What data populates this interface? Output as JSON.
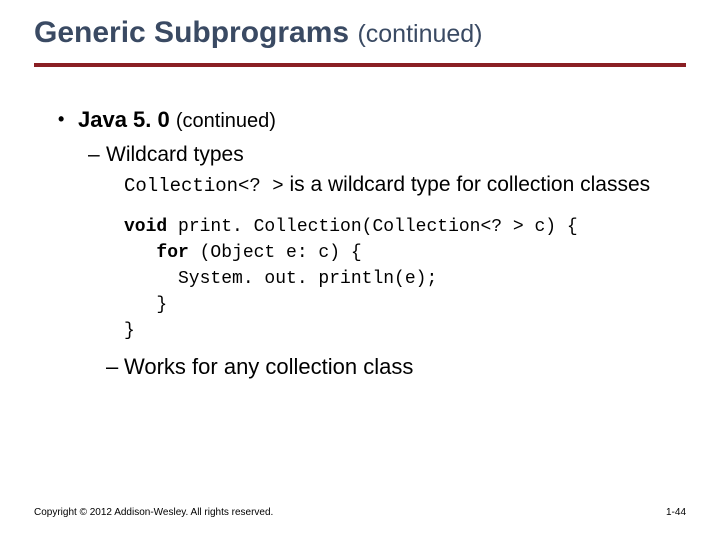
{
  "title": {
    "main": "Generic Subprograms",
    "cont": "(continued)"
  },
  "bullets": {
    "java_label": "Java 5. 0",
    "java_cont": "(continued)",
    "wildcard_label": "Wildcard types",
    "wildcard_code": "Collection<? >",
    "wildcard_desc_tail": " is a wildcard type for collection classes",
    "code_l1a": "void",
    "code_l1b": " print. Collection(Collection<? > c) {",
    "code_l2a": "   for",
    "code_l2b": " (Object e: c) {",
    "code_l3": "     System. out. println(e);",
    "code_l4": "   }",
    "code_l5": "}",
    "works_line": "Works for any collection class"
  },
  "footer": {
    "copyright": "Copyright © 2012 Addison-Wesley. All rights reserved.",
    "page": "1-44"
  }
}
